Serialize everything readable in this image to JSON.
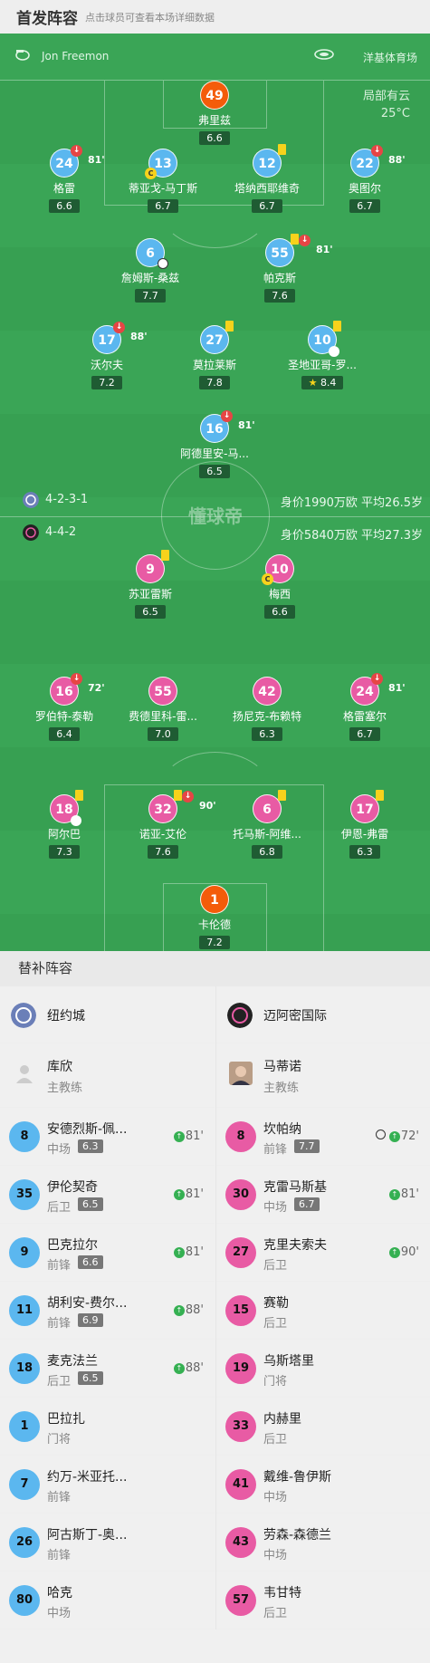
{
  "header": {
    "title": "首发阵容",
    "subtitle": "点击球员可查看本场详细数据"
  },
  "match": {
    "referee": "Jon Freemon",
    "stadium": "洋基体育场",
    "weather": "局部有云",
    "temperature": "25°C",
    "watermark": "懂球帝"
  },
  "teams": {
    "home": {
      "name": "纽约城",
      "formation": "4-2-3-1",
      "value_line": "身价1990万欧 平均26.5岁",
      "color": "#5bb7ef"
    },
    "away": {
      "name": "迈阿密国际",
      "formation": "4-4-2",
      "value_line": "身价5840万欧 平均27.3岁",
      "color": "#e85ba4"
    }
  },
  "home_players": [
    {
      "num": "49",
      "name": "弗里兹",
      "rating": "6.6"
    },
    {
      "num": "24",
      "name": "格雷",
      "rating": "6.6",
      "sub_minute": "81'"
    },
    {
      "num": "13",
      "name": "蒂亚戈-马丁斯",
      "rating": "6.7"
    },
    {
      "num": "12",
      "name": "塔纳西耶维奇",
      "rating": "6.7"
    },
    {
      "num": "22",
      "name": "奥图尔",
      "rating": "6.7",
      "sub_minute": "88'"
    },
    {
      "num": "6",
      "name": "詹姆斯-桑兹",
      "rating": "7.7"
    },
    {
      "num": "55",
      "name": "帕克斯",
      "rating": "7.6",
      "sub_minute": "81'"
    },
    {
      "num": "17",
      "name": "沃尔夫",
      "rating": "7.2",
      "sub_minute": "88'"
    },
    {
      "num": "27",
      "name": "莫拉莱斯",
      "rating": "7.8"
    },
    {
      "num": "10",
      "name": "圣地亚哥-罗...",
      "rating": "8.4"
    },
    {
      "num": "16",
      "name": "阿德里安-马...",
      "rating": "6.5",
      "sub_minute": "81'"
    }
  ],
  "away_players": [
    {
      "num": "9",
      "name": "苏亚雷斯",
      "rating": "6.5"
    },
    {
      "num": "10",
      "name": "梅西",
      "rating": "6.6"
    },
    {
      "num": "16",
      "name": "罗伯特-泰勒",
      "rating": "6.4",
      "sub_minute": "72'"
    },
    {
      "num": "55",
      "name": "费德里科-雷...",
      "rating": "7.0"
    },
    {
      "num": "42",
      "name": "扬尼克-布赖特",
      "rating": "6.3"
    },
    {
      "num": "24",
      "name": "格雷塞尔",
      "rating": "6.7",
      "sub_minute": "81'"
    },
    {
      "num": "18",
      "name": "阿尔巴",
      "rating": "7.3"
    },
    {
      "num": "32",
      "name": "诺亚-艾伦",
      "rating": "7.6",
      "sub_minute": "90'"
    },
    {
      "num": "6",
      "name": "托马斯-阿维...",
      "rating": "6.8"
    },
    {
      "num": "17",
      "name": "伊恩-弗雷",
      "rating": "6.3"
    },
    {
      "num": "1",
      "name": "卡伦德",
      "rating": "7.2"
    }
  ],
  "bench": {
    "title": "替补阵容",
    "coach_role": "主教练",
    "home_coach": "库欣",
    "away_coach": "马蒂诺",
    "home": [
      {
        "num": "8",
        "name": "安德烈斯-佩...",
        "pos": "中场",
        "rating": "6.3",
        "sub": "81'"
      },
      {
        "num": "35",
        "name": "伊伦契奇",
        "pos": "后卫",
        "rating": "6.5",
        "sub": "81'"
      },
      {
        "num": "9",
        "name": "巴克拉尔",
        "pos": "前锋",
        "rating": "6.6",
        "sub": "81'"
      },
      {
        "num": "11",
        "name": "胡利安-费尔...",
        "pos": "前锋",
        "rating": "6.9",
        "sub": "88'"
      },
      {
        "num": "18",
        "name": "麦克法兰",
        "pos": "后卫",
        "rating": "6.5",
        "sub": "88'"
      },
      {
        "num": "1",
        "name": "巴拉扎",
        "pos": "门将"
      },
      {
        "num": "7",
        "name": "约万-米亚托...",
        "pos": "前锋"
      },
      {
        "num": "26",
        "name": "阿古斯丁-奥...",
        "pos": "前锋"
      },
      {
        "num": "80",
        "name": "哈克",
        "pos": "中场"
      }
    ],
    "away": [
      {
        "num": "8",
        "name": "坎帕纳",
        "pos": "前锋",
        "rating": "7.7",
        "sub": "72'",
        "goal": true
      },
      {
        "num": "30",
        "name": "克雷马斯基",
        "pos": "中场",
        "rating": "6.7",
        "sub": "81'"
      },
      {
        "num": "27",
        "name": "克里夫索夫",
        "pos": "后卫",
        "sub": "90'"
      },
      {
        "num": "15",
        "name": "赛勒",
        "pos": "后卫"
      },
      {
        "num": "19",
        "name": "乌斯塔里",
        "pos": "门将"
      },
      {
        "num": "33",
        "name": "内赫里",
        "pos": "后卫"
      },
      {
        "num": "41",
        "name": "戴维-鲁伊斯",
        "pos": "中场"
      },
      {
        "num": "43",
        "name": "劳森-森德兰",
        "pos": "中场"
      },
      {
        "num": "57",
        "name": "韦甘特",
        "pos": "后卫"
      }
    ]
  }
}
